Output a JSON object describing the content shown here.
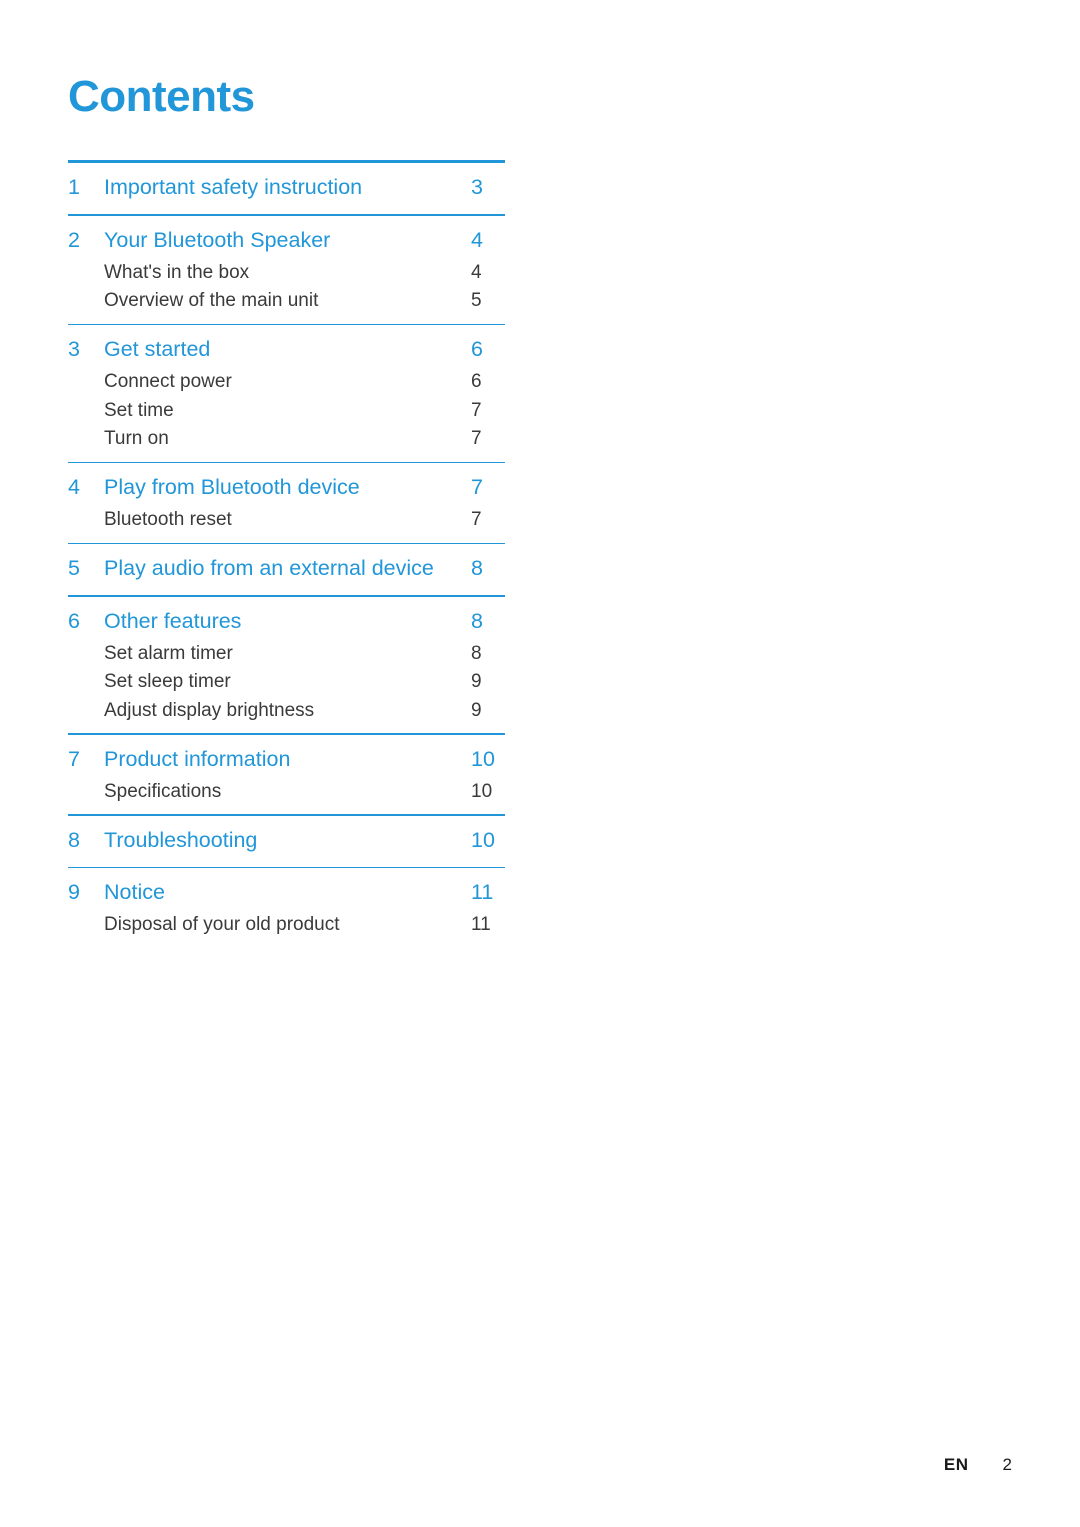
{
  "document": {
    "title": "Contents",
    "accent_color": "#2196d8",
    "body_text_color": "#3a3a3a"
  },
  "toc": {
    "groups": [
      {
        "chapter": {
          "num": "1",
          "label": "Important safety instruction",
          "page": "3"
        },
        "entries": []
      },
      {
        "chapter": {
          "num": "2",
          "label": "Your Bluetooth Speaker",
          "page": "4"
        },
        "entries": [
          {
            "label": "What's in the box",
            "page": "4"
          },
          {
            "label": "Overview of the main unit",
            "page": "5"
          }
        ]
      },
      {
        "chapter": {
          "num": "3",
          "label": "Get started",
          "page": "6"
        },
        "entries": [
          {
            "label": "Connect power",
            "page": "6"
          },
          {
            "label": "Set time",
            "page": "7"
          },
          {
            "label": "Turn on",
            "page": "7"
          }
        ]
      },
      {
        "chapter": {
          "num": "4",
          "label": "Play from Bluetooth device",
          "page": "7"
        },
        "entries": [
          {
            "label": "Bluetooth reset",
            "page": "7"
          }
        ]
      },
      {
        "chapter": {
          "num": "5",
          "label": "Play audio from an external device",
          "page": "8"
        },
        "entries": []
      },
      {
        "chapter": {
          "num": "6",
          "label": "Other features",
          "page": "8"
        },
        "entries": [
          {
            "label": "Set alarm timer",
            "page": "8"
          },
          {
            "label": "Set sleep timer",
            "page": "9"
          },
          {
            "label": "Adjust display brightness",
            "page": "9"
          }
        ]
      },
      {
        "chapter": {
          "num": "7",
          "label": "Product information",
          "page": "10"
        },
        "entries": [
          {
            "label": "Specifications",
            "page": "10"
          }
        ]
      },
      {
        "chapter": {
          "num": "8",
          "label": "Troubleshooting",
          "page": "10"
        },
        "entries": []
      },
      {
        "chapter": {
          "num": "9",
          "label": "Notice",
          "page": "11"
        },
        "entries": [
          {
            "label": "Disposal of your old product",
            "page": "11"
          }
        ]
      }
    ]
  },
  "footer": {
    "language": "EN",
    "page_number": "2"
  }
}
